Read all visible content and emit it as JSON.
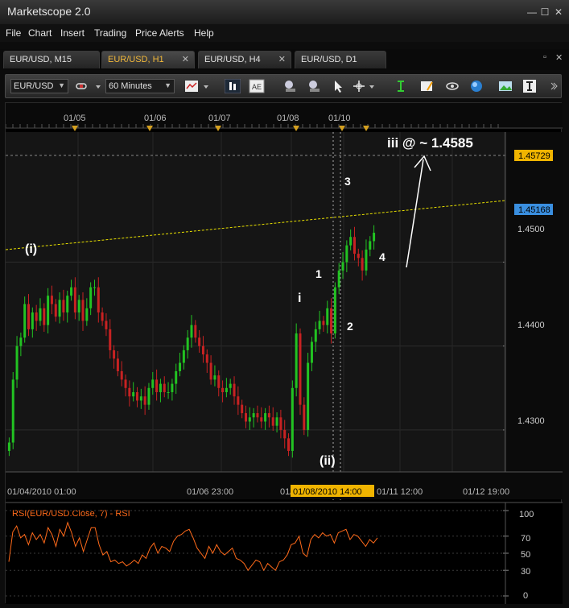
{
  "app": {
    "title": "Marketscope 2.0"
  },
  "window_controls": {
    "minimize": "—",
    "maximize": "☐",
    "close": "✕"
  },
  "menu": {
    "items": [
      "File",
      "Chart",
      "Insert",
      "Trading",
      "Price Alerts",
      "Help"
    ]
  },
  "tabs": [
    {
      "label": "EUR/USD, M15",
      "active": false
    },
    {
      "label": "EUR/USD, H1",
      "active": true
    },
    {
      "label": "EUR/USD, H4",
      "active": false
    },
    {
      "label": "EUR/USD, D1",
      "active": false
    }
  ],
  "tab_close_glyph": "✕",
  "toolbar": {
    "symbol": "EUR/USD",
    "timeframe": "60 Minutes"
  },
  "chart_data": [
    {
      "type": "candlestick",
      "symbol": "EUR/USD",
      "timeframe": "H1",
      "y_ticks": [
        "1.4500",
        "1.4400",
        "1.4300"
      ],
      "y_range": [
        1.425,
        1.4655
      ],
      "price_markers": [
        {
          "label": "1.45729",
          "value": 1.45729,
          "color": "#f0b400"
        },
        {
          "label": "1.45168",
          "value": 1.45168,
          "color": "#3a8fe0"
        }
      ],
      "top_date_labels": [
        "01/05",
        "01/06",
        "01/07",
        "01/08",
        "01/10"
      ],
      "x_labels": [
        "01/04/2010 01:00",
        "01/06 23:00",
        "01/",
        "01/08/2010 14:00",
        "01/11 12:00",
        "01/12 19:00"
      ],
      "annotations": [
        "(i)",
        "i",
        "1",
        "2",
        "3",
        "4",
        "(ii)",
        "iii @ ~ 1.4585"
      ],
      "close_series": [
        1.4285,
        1.436,
        1.44,
        1.441,
        1.445,
        1.442,
        1.444,
        1.443,
        1.4445,
        1.4425,
        1.446,
        1.445,
        1.4435,
        1.4455,
        1.444,
        1.446,
        1.447,
        1.444,
        1.4455,
        1.443,
        1.4445,
        1.447,
        1.447,
        1.444,
        1.443,
        1.442,
        1.4395,
        1.4385,
        1.437,
        1.436,
        1.435,
        1.434,
        1.4345,
        1.4335,
        1.434,
        1.433,
        1.435,
        1.436,
        1.4345,
        1.4355,
        1.4345,
        1.4345,
        1.4355,
        1.437,
        1.438,
        1.4395,
        1.441,
        1.4425,
        1.441,
        1.44,
        1.439,
        1.438,
        1.436,
        1.4365,
        1.435,
        1.4345,
        1.435,
        1.4355,
        1.434,
        1.433,
        1.432,
        1.431,
        1.4315,
        1.432,
        1.4315,
        1.431,
        1.432,
        1.4315,
        1.4305,
        1.4315,
        1.43,
        1.429,
        1.4275,
        1.435,
        1.4415,
        1.433,
        1.43,
        1.438,
        1.4405,
        1.442,
        1.443,
        1.4425,
        1.4445,
        1.4415,
        1.447,
        1.449,
        1.45,
        1.452,
        1.453,
        1.451,
        1.4505,
        1.449,
        1.4515,
        1.4525,
        1.4535
      ]
    },
    {
      "type": "line",
      "title": "RSI(EUR/USD.Close, 7) - RSI",
      "y_ticks": [
        "100",
        "70",
        "50",
        "30",
        "0"
      ],
      "y_range": [
        0,
        100
      ],
      "color": "#ff6a1a",
      "values": [
        40,
        75,
        82,
        68,
        72,
        60,
        74,
        66,
        72,
        62,
        80,
        72,
        58,
        78,
        70,
        86,
        74,
        58,
        68,
        52,
        66,
        80,
        80,
        60,
        48,
        52,
        40,
        42,
        38,
        40,
        35,
        38,
        42,
        38,
        48,
        44,
        56,
        62,
        50,
        58,
        56,
        52,
        64,
        70,
        72,
        76,
        78,
        68,
        56,
        50,
        44,
        58,
        50,
        60,
        52,
        48,
        52,
        56,
        44,
        42,
        38,
        30,
        36,
        42,
        40,
        30,
        38,
        34,
        30,
        40,
        42,
        48,
        60,
        62,
        70,
        50,
        46,
        66,
        72,
        68,
        74,
        70,
        72,
        62,
        74,
        76,
        78,
        66,
        72,
        70,
        64,
        58,
        66,
        62,
        68
      ]
    }
  ]
}
